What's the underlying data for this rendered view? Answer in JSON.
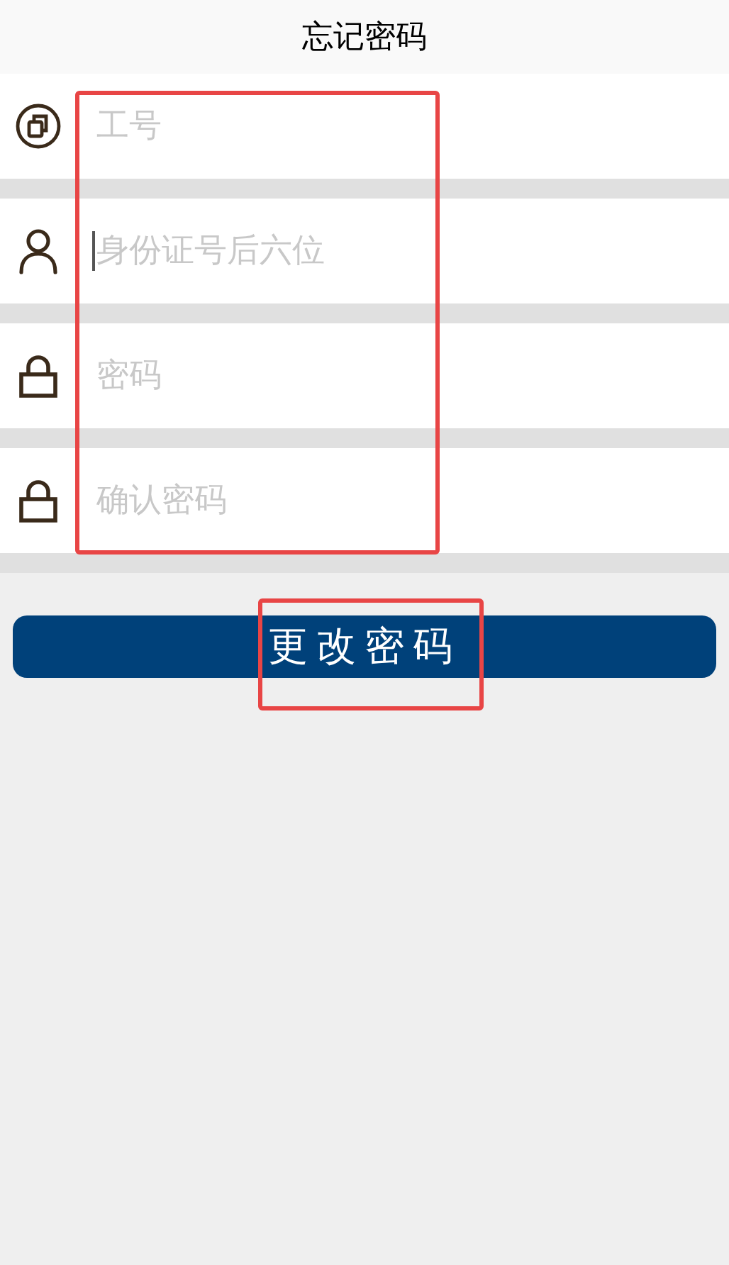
{
  "header": {
    "title": "忘记密码"
  },
  "fields": [
    {
      "kind": "badge",
      "placeholder": "工号",
      "focused": false
    },
    {
      "kind": "person",
      "placeholder": "身份证号后六位",
      "focused": true
    },
    {
      "kind": "lock",
      "placeholder": "密码",
      "focused": false
    },
    {
      "kind": "lock",
      "placeholder": "确认密码",
      "focused": false
    }
  ],
  "submit_button": {
    "label": "更改密码"
  }
}
